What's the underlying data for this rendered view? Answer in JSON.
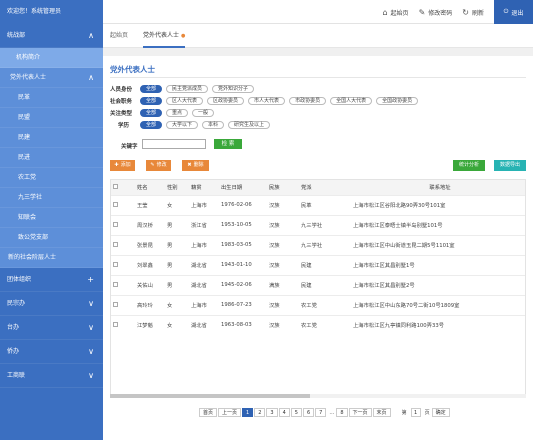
{
  "header": {
    "welcome": "欢迎您！系统管理员",
    "home": "起始页",
    "change_password": "修改密码",
    "refresh": "刷新",
    "logout": "退出"
  },
  "sidebar": {
    "groups": [
      {
        "label": "统战部",
        "arrow": "∧"
      },
      {
        "label": "机构简介"
      },
      {
        "label": "党外代表人士",
        "arrow": "∧"
      },
      {
        "label": "民革"
      },
      {
        "label": "民盟"
      },
      {
        "label": "民建"
      },
      {
        "label": "民进"
      },
      {
        "label": "农工党"
      },
      {
        "label": "九三学社"
      },
      {
        "label": "知联会"
      },
      {
        "label": "致公党支部"
      },
      {
        "label": "新的社会阶层人士"
      },
      {
        "label": "团体组织",
        "arrow": "+"
      },
      {
        "label": "民宗办",
        "arrow": "∨"
      },
      {
        "label": "台办",
        "arrow": "∨"
      },
      {
        "label": "侨办",
        "arrow": "∨"
      },
      {
        "label": "工商联",
        "arrow": "∨"
      }
    ]
  },
  "tabs": [
    {
      "label": "起始页"
    },
    {
      "label": "党外代表人士"
    }
  ],
  "page_title": "党外代表人士",
  "filters": [
    {
      "label": "人员身份",
      "chips": [
        "全部",
        "民主党派成员",
        "党外知识分子"
      ]
    },
    {
      "label": "社会职务",
      "chips": [
        "全部",
        "区人大代表",
        "区政协委员",
        "市人大代表",
        "市政协委员",
        "全国人大代表",
        "全国政协委员"
      ]
    },
    {
      "label": "关注类型",
      "chips": [
        "全部",
        "重点",
        "一般"
      ]
    },
    {
      "label": "学历",
      "chips": [
        "全部",
        "大学以下",
        "本科",
        "研究生及以上"
      ]
    }
  ],
  "search": {
    "label": "关键字",
    "value": "",
    "button": "检 索"
  },
  "toolbar": {
    "add": "添加",
    "edit": "修改",
    "delete": "删除",
    "stats": "统计分析",
    "export": "数据导出"
  },
  "table": {
    "columns": [
      "",
      "姓名",
      "性别",
      "籍贯",
      "出生日期",
      "民族",
      "党派",
      "联系地址"
    ],
    "rows": [
      [
        "",
        "王莹",
        "女",
        "上海市",
        "1976-02-06",
        "汉族",
        "民革",
        "上海市松江区谷阳北路90弄30号101室"
      ],
      [
        "",
        "周汉桥",
        "男",
        "浙江省",
        "1953-10-05",
        "汉族",
        "九三学社",
        "上海市松江区泰晤士镇半岛别墅101号"
      ],
      [
        "",
        "张景昆",
        "男",
        "上海市",
        "1983-03-05",
        "汉族",
        "九三学社",
        "上海市松江区中山街道玉昆二期5号1101室"
      ],
      [
        "",
        "刘翠鑫",
        "男",
        "湖北省",
        "1943-01-10",
        "汉族",
        "民建",
        "上海市松江区其昌别墅1号"
      ],
      [
        "",
        "关佑山",
        "男",
        "湖北省",
        "1945-02-06",
        "满族",
        "民建",
        "上海市松江区其昌别墅2号"
      ],
      [
        "",
        "高玲玲",
        "女",
        "上海市",
        "1986-07-23",
        "汉族",
        "农工党",
        "上海市松江区中山东路70号二街10号1809室"
      ],
      [
        "",
        "江梦魁",
        "女",
        "湖北省",
        "1963-08-03",
        "汉族",
        "农工党",
        "上海市松江区九亭镇同利路100弄33号"
      ]
    ]
  },
  "pager": {
    "first": "首页",
    "prev": "上一页",
    "pages": [
      "1",
      "2",
      "3",
      "4",
      "5",
      "6",
      "7"
    ],
    "ellipsis": "…",
    "last_page": "8",
    "next": "下一页",
    "end": "末页",
    "goto_prefix": "第",
    "goto_value": "1",
    "goto_suffix": "页",
    "confirm": "确定"
  }
}
